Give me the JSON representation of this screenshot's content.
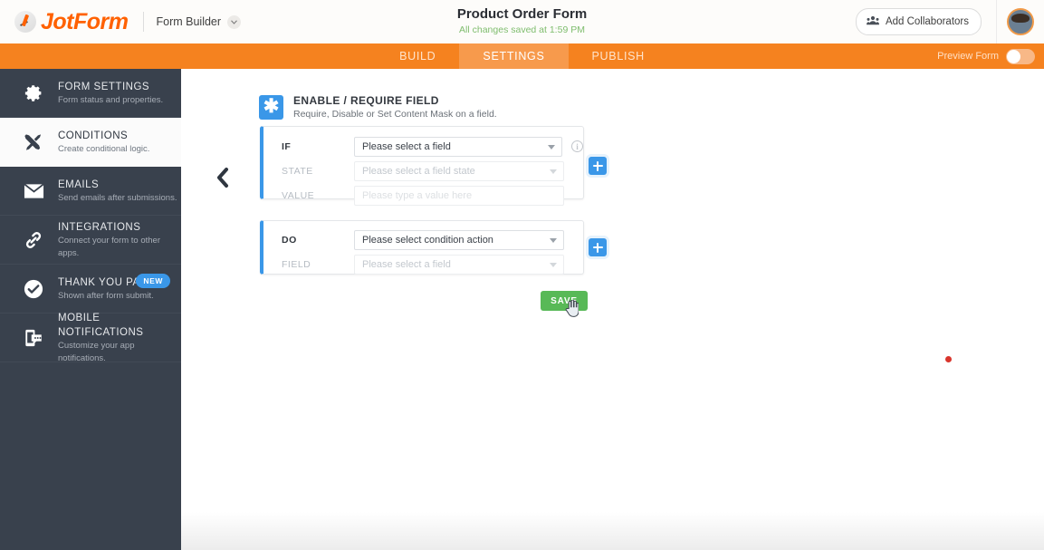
{
  "topbar": {
    "brand_name": "JotForm",
    "brand_mark_icon": "jotform-logo-icon",
    "app_switcher_label": "Form Builder",
    "app_switcher_icon": "chevron-down-icon",
    "form_title": "Product Order Form",
    "save_status": "All changes saved at 1:59 PM",
    "collaborators_label": "Add Collaborators",
    "collaborators_icon": "people-group-icon",
    "avatar_icon": "user-avatar"
  },
  "navbar": {
    "tabs": [
      {
        "label": "BUILD",
        "active": false
      },
      {
        "label": "SETTINGS",
        "active": true
      },
      {
        "label": "PUBLISH",
        "active": false
      }
    ],
    "preview_label": "Preview Form",
    "toggle_state": "off"
  },
  "sidebar": {
    "items": [
      {
        "title": "FORM SETTINGS",
        "subtitle": "Form status and properties.",
        "icon": "gear-icon",
        "active": false,
        "badge": ""
      },
      {
        "title": "CONDITIONS",
        "subtitle": "Create conditional logic.",
        "icon": "crossed-tools-icon",
        "active": true,
        "badge": ""
      },
      {
        "title": "EMAILS",
        "subtitle": "Send emails after submissions.",
        "icon": "envelope-icon",
        "active": false,
        "badge": ""
      },
      {
        "title": "INTEGRATIONS",
        "subtitle": "Connect your form to other apps.",
        "icon": "chain-link-icon",
        "active": false,
        "badge": ""
      },
      {
        "title": "THANK YOU PAGE",
        "subtitle": "Shown after form submit.",
        "icon": "check-circle-icon",
        "active": false,
        "badge": "NEW"
      },
      {
        "title": "MOBILE NOTIFICATIONS",
        "subtitle": "Customize your app notifications.",
        "icon": "mobile-chat-icon",
        "active": false,
        "badge": ""
      }
    ]
  },
  "panel": {
    "back_icon": "back-chevron-icon",
    "icon": "asterisk-icon",
    "icon_glyph": "✱",
    "title": "ENABLE / REQUIRE FIELD",
    "subtitle": "Require, Disable or Set Content Mask on a field.",
    "if_card": {
      "rows": [
        {
          "label": "IF",
          "value": "Please select a field",
          "type": "select",
          "disabled": false
        },
        {
          "label": "STATE",
          "value": "Please select a field state",
          "type": "select",
          "disabled": true
        },
        {
          "label": "VALUE",
          "value": "Please type a value here",
          "type": "input",
          "disabled": true
        }
      ],
      "info_icon": "info-icon",
      "add_icon": "plus-icon"
    },
    "do_card": {
      "rows": [
        {
          "label": "DO",
          "value": "Please select condition action",
          "type": "select",
          "disabled": false
        },
        {
          "label": "FIELD",
          "value": "Please select a field",
          "type": "select",
          "disabled": true
        }
      ],
      "add_icon": "plus-icon"
    },
    "save_label": "SAVE"
  },
  "markers": {
    "red_dot_icon": "red-dot-marker",
    "cursor_icon": "pointer-hand-cursor"
  },
  "colors": {
    "brand_orange": "#ff6100",
    "nav_orange": "#f5821f",
    "nav_active_orange": "#f79a4c",
    "sidebar_dark": "#39414d",
    "accent_blue": "#3a97e8",
    "save_green": "#58b957",
    "status_green": "#7fbd6e",
    "red_marker": "#d9352c"
  }
}
